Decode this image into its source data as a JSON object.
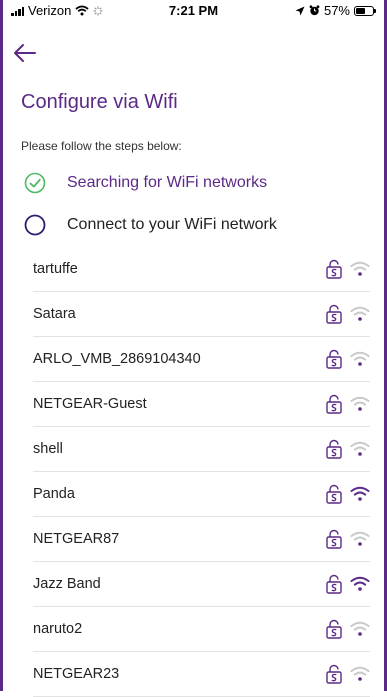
{
  "status_bar": {
    "carrier": "Verizon",
    "time": "7:21 PM",
    "battery": "57%",
    "battery_level": 0.57,
    "icons": [
      "signal-icon",
      "wifi-status-icon",
      "activity-icon",
      "location-icon",
      "alarm-icon",
      "battery-icon"
    ]
  },
  "header": {
    "back_icon": "back-arrow-icon"
  },
  "page": {
    "title": "Configure via Wifi",
    "subtitle": "Please follow the steps below:"
  },
  "steps": [
    {
      "label": "Searching for WiFi networks",
      "status": "complete",
      "icon": "check-circle-icon"
    },
    {
      "label": "Connect to your WiFi network",
      "status": "pending",
      "icon": "circle-icon"
    }
  ],
  "networks": [
    {
      "name": "tartuffe",
      "secured": true,
      "signal": 1
    },
    {
      "name": "Satara",
      "secured": true,
      "signal": 1
    },
    {
      "name": "ARLO_VMB_2869104340",
      "secured": true,
      "signal": 1
    },
    {
      "name": "NETGEAR-Guest",
      "secured": true,
      "signal": 1
    },
    {
      "name": "shell",
      "secured": true,
      "signal": 1
    },
    {
      "name": "Panda",
      "secured": true,
      "signal": 3
    },
    {
      "name": "NETGEAR87",
      "secured": true,
      "signal": 1
    },
    {
      "name": "Jazz Band",
      "secured": true,
      "signal": 3
    },
    {
      "name": "naruto2",
      "secured": true,
      "signal": 1
    },
    {
      "name": "NETGEAR23",
      "secured": true,
      "signal": 1
    }
  ],
  "colors": {
    "accent": "#5b2a86",
    "success": "#4cb963",
    "wifi_strong": "#5b2a86",
    "wifi_weak": "#c9c9c9",
    "divider": "#e3e3e3"
  }
}
